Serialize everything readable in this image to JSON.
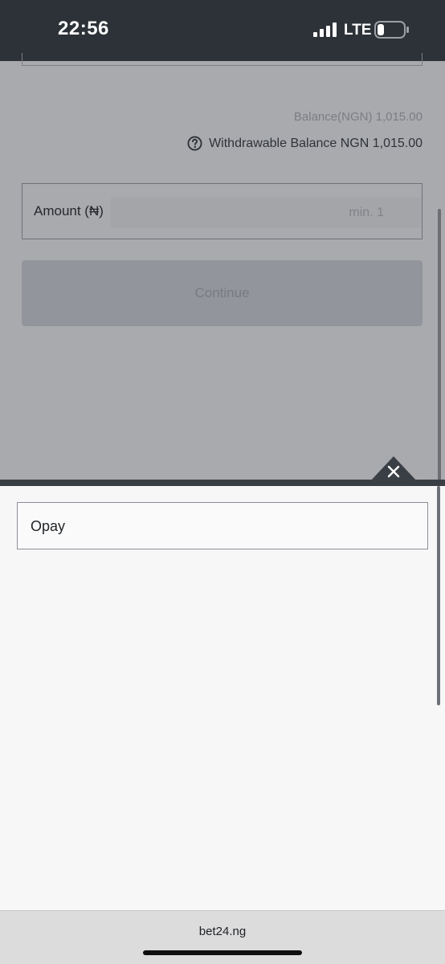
{
  "status_bar": {
    "time": "22:56",
    "network": "LTE",
    "signal_icon": "cellular-signal-icon",
    "battery_icon": "battery-low-icon"
  },
  "page": {
    "balance_text": "Balance(NGN) 1,015.00",
    "withdrawable_text": "Withdrawable Balance NGN 1,015.00",
    "help_icon": "question-circle-icon",
    "amount_label": "Amount (₦)",
    "amount_placeholder": "min. 1",
    "amount_value": "",
    "continue_label": "Continue"
  },
  "sheet": {
    "close_icon": "close-icon",
    "options": [
      "Opay"
    ]
  },
  "browser": {
    "url": "bet24.ng"
  },
  "colors": {
    "status_bar_bg": "#2c3237",
    "overlay_dim": "#a9aaae",
    "sheet_bg": "#f7f7f8",
    "divider": "#3a3f45"
  }
}
